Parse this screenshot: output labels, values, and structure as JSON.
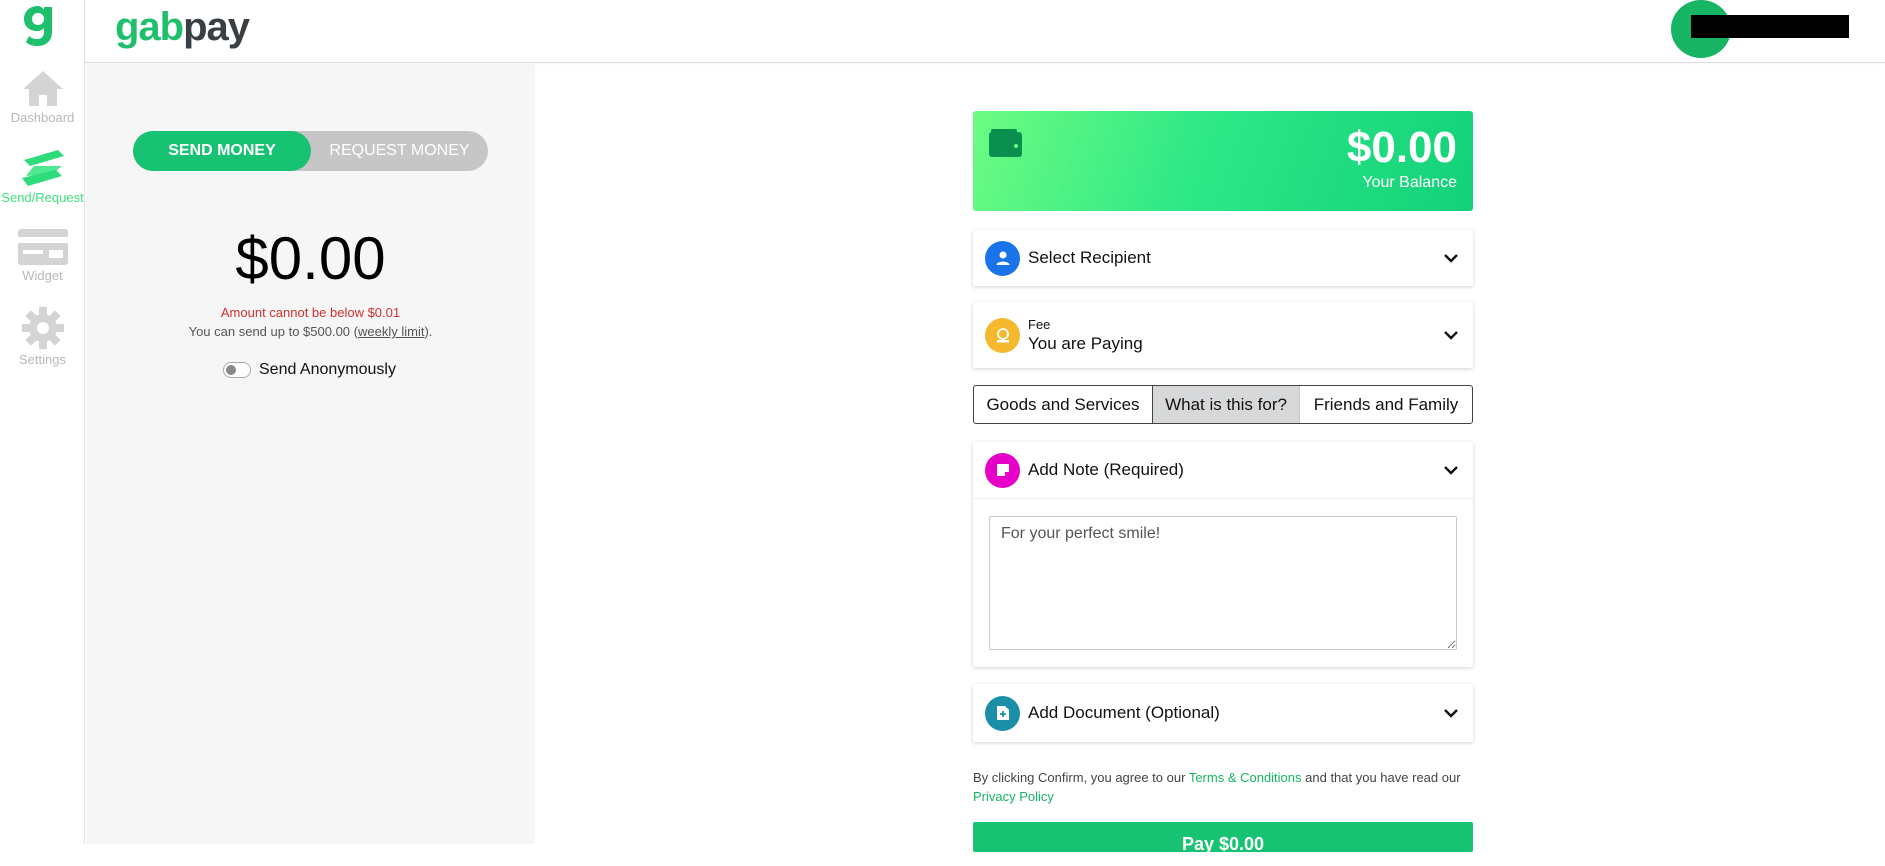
{
  "brand": {
    "part1": "gab",
    "part2": "pay"
  },
  "nav": {
    "items": [
      {
        "label": "Dashboard",
        "icon": "home-icon",
        "active": false
      },
      {
        "label": "Send/Request",
        "icon": "send-request-icon",
        "active": true
      },
      {
        "label": "Widget",
        "icon": "widget-icon",
        "active": false
      },
      {
        "label": "Settings",
        "icon": "gear-icon",
        "active": false
      }
    ]
  },
  "transfer": {
    "send_label": "SEND MONEY",
    "request_label": "REQUEST MONEY",
    "amount": "$0.00",
    "error": "Amount cannot be below $0.01",
    "limit_prefix": "You can send up to $500.00 (",
    "limit_link": "weekly limit",
    "limit_suffix": ").",
    "anonymous_label": "Send Anonymously"
  },
  "balance": {
    "amount": "$0.00",
    "label": "Your Balance"
  },
  "recipient": {
    "label": "Select Recipient"
  },
  "fee": {
    "small_label": "Fee",
    "value": "You are Paying"
  },
  "purpose": {
    "options": [
      "Goods and Services",
      "What is this for?",
      "Friends and Family"
    ]
  },
  "note": {
    "label": "Add Note (Required)",
    "placeholder": "For your perfect smile!"
  },
  "document": {
    "label": "Add Document (Optional)"
  },
  "terms": {
    "prefix": "By clicking Confirm, you agree to our ",
    "terms_link": "Terms & Conditions",
    "middle": " and that you have read our",
    "privacy_link": "Privacy Policy"
  },
  "confirm": {
    "label": "Pay $0.00"
  },
  "colors": {
    "brand_green": "#17c373",
    "recipient_icon": "#1a73e8",
    "fee_icon": "#f5b82e",
    "note_icon": "#e600c8",
    "document_icon": "#1b8fa8",
    "error": "#d13030"
  }
}
